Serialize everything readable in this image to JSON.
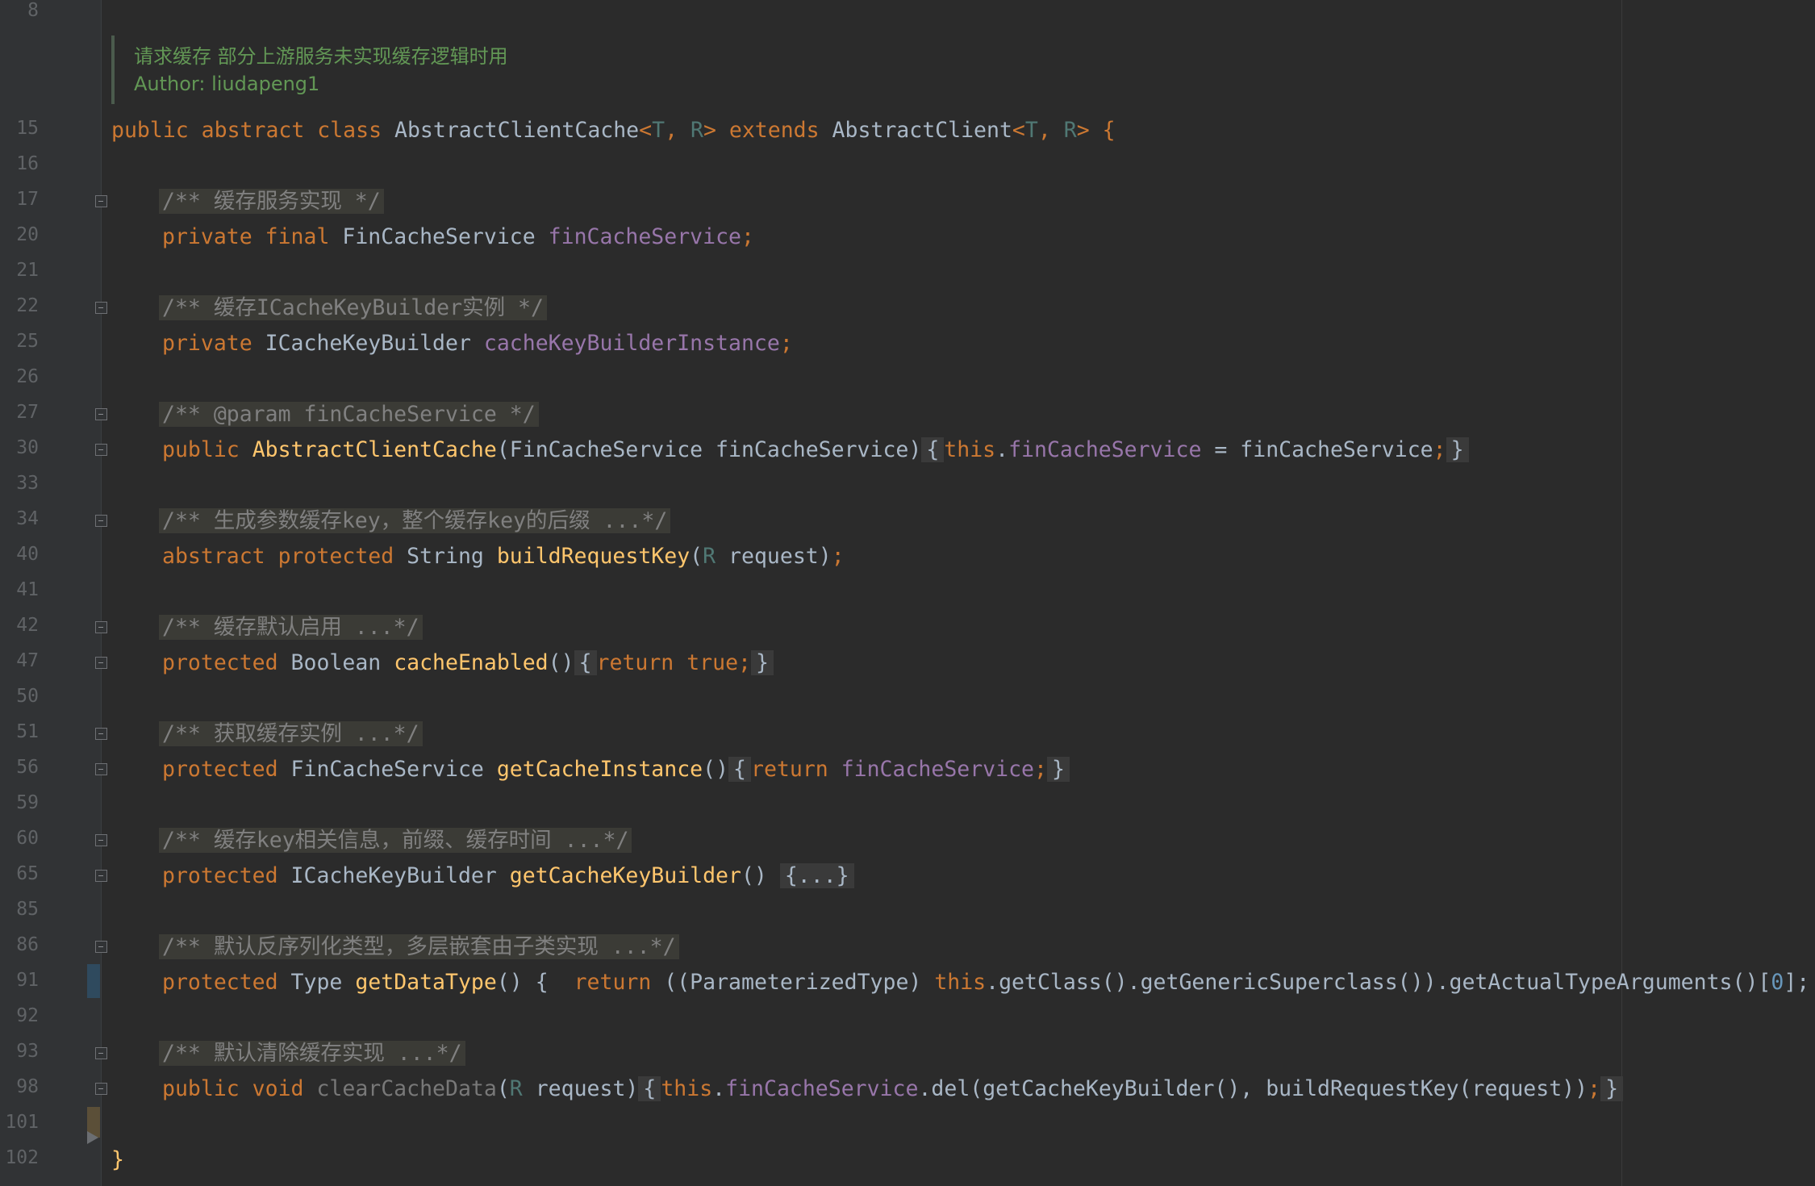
{
  "doc_comment": {
    "line1": "请求缓存 部分上游服务未实现缓存逻辑时用",
    "line2": "Author: liudapeng1"
  },
  "line_numbers": [
    "8",
    "15",
    "16",
    "17",
    "20",
    "21",
    "22",
    "25",
    "26",
    "27",
    "30",
    "33",
    "34",
    "40",
    "41",
    "42",
    "47",
    "50",
    "51",
    "56",
    "59",
    "60",
    "65",
    "85",
    "86",
    "91",
    "92",
    "93",
    "98",
    "101",
    "102"
  ],
  "code": {
    "class_decl": {
      "kw1": "public abstract class ",
      "name": "AbstractClientCache",
      "lt": "<",
      "t": "T",
      "comma": ", ",
      "r": "R",
      "gt": "> ",
      "extends": "extends ",
      "parent": "AbstractClient",
      "lt2": "<",
      "t2": "T",
      "comma2": ", ",
      "r2": "R",
      "gt2": "> {"
    },
    "c17": "/** 缓存服务实现 */",
    "l20": {
      "kw": "private final ",
      "type": "FinCacheService ",
      "field": "finCacheService",
      "semi": ";"
    },
    "c22": "/** 缓存ICacheKeyBuilder实例 */",
    "l25": {
      "kw": "private ",
      "type": "ICacheKeyBuilder ",
      "field": "cacheKeyBuilderInstance",
      "semi": ";"
    },
    "c27": "/** @param finCacheService */",
    "l30": {
      "kw": "public ",
      "name": "AbstractClientCache",
      "params": "(FinCacheService finCacheService)",
      "open": "{",
      "this": "this",
      "dot": ".",
      "field": "finCacheService",
      "assign": " = finCacheService",
      "semi": ";",
      "close": "}"
    },
    "c34": "/** 生成参数缓存key，整个缓存key的后缀 ...*/",
    "l40": {
      "kw": "abstract protected ",
      "type": "String ",
      "name": "buildRequestKey",
      "p_open": "(",
      "tparam": "R",
      "p_rest": " request)",
      "semi": ";"
    },
    "c42": "/** 缓存默认启用 ...*/",
    "l47": {
      "kw": "protected ",
      "type": "Boolean ",
      "name": "cacheEnabled",
      "parens": "()",
      "open": "{",
      "ret": "return true;",
      "close": "}"
    },
    "c51": "/** 获取缓存实例 ...*/",
    "l56": {
      "kw": "protected ",
      "type": "FinCacheService ",
      "name": "getCacheInstance",
      "parens": "()",
      "open": "{",
      "ret": "return ",
      "field": "finCacheService",
      "semi": ";",
      "close": "}"
    },
    "c60": "/** 缓存key相关信息，前缀、缓存时间 ...*/",
    "l65": {
      "kw": "protected ",
      "type": "ICacheKeyBuilder ",
      "name": "getCacheKeyBuilder",
      "parens": "() ",
      "folded": "{...}"
    },
    "c86": "/** 默认反序列化类型，多层嵌套由子类实现 ...*/",
    "l91": {
      "kw": "protected ",
      "type": "Type ",
      "name": "getDataType",
      "parens": "() ",
      "open": "{  ",
      "ret": "return ",
      "cast": "((ParameterizedType) ",
      "this": "this",
      "chain": ".getClass().getGenericSuperclass()).getActualTypeArguments()[",
      "idx": "0",
      "end": "];  }"
    },
    "c93": "/** 默认清除缓存实现 ...*/",
    "l98": {
      "kw": "public void ",
      "name": "clearCacheData",
      "p_open": "(",
      "tparam": "R",
      "p_rest": " request)",
      "open": "{",
      "this": "this",
      "dot": ".",
      "field": "finCacheService",
      "call": ".del(getCacheKeyBuilder(), buildRequestKey(request))",
      "semi": ";",
      "close": "}"
    },
    "end": "}"
  }
}
